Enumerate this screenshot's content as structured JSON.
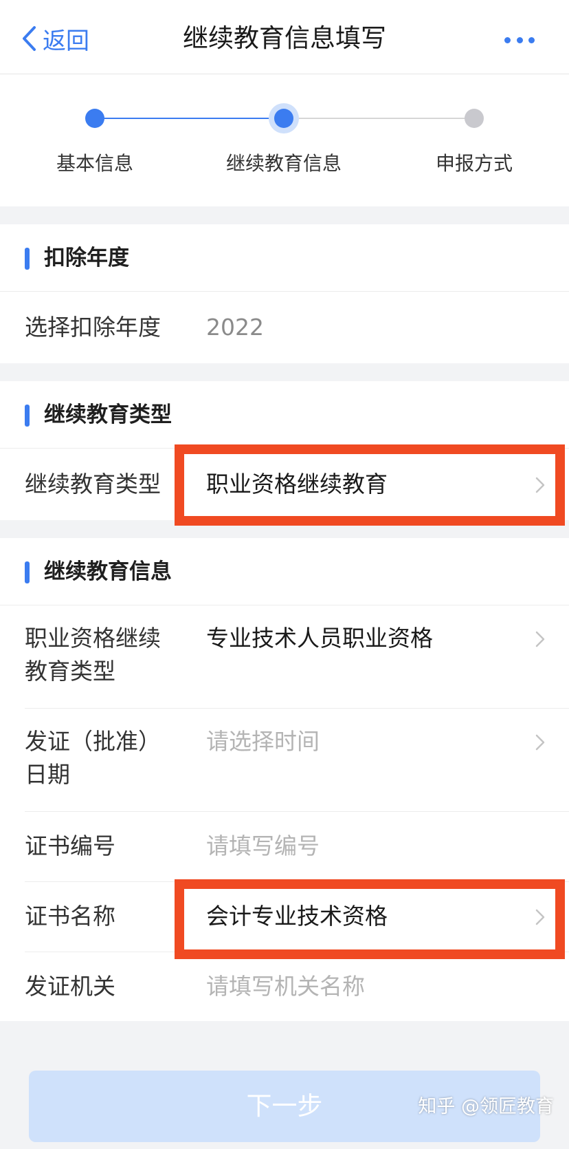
{
  "header": {
    "back_label": "返回",
    "title": "继续教育信息填写",
    "more_icon": "ellipsis-icon"
  },
  "steps": [
    {
      "label": "基本信息",
      "state": "done"
    },
    {
      "label": "继续教育信息",
      "state": "current"
    },
    {
      "label": "申报方式",
      "state": "todo"
    }
  ],
  "section_year": {
    "title": "扣除年度",
    "rows": [
      {
        "label": "选择扣除年度",
        "value": "2022"
      }
    ]
  },
  "section_type": {
    "title": "继续教育类型",
    "rows": [
      {
        "label": "继续教育类型",
        "value": "职业资格继续教育"
      }
    ]
  },
  "section_info": {
    "title": "继续教育信息",
    "rows": [
      {
        "label": "职业资格继续教育类型",
        "value": "专业技术人员职业资格"
      },
      {
        "label": "发证（批准）日期",
        "placeholder": "请选择时间"
      },
      {
        "label": "证书编号",
        "placeholder": "请填写编号"
      },
      {
        "label": "证书名称",
        "value": "会计专业技术资格"
      },
      {
        "label": "发证机关",
        "placeholder": "请填写机关名称"
      }
    ]
  },
  "footer": {
    "next_label": "下一步",
    "watermark": "知乎 @领匠教育"
  },
  "colors": {
    "accent": "#3b7cf0",
    "highlight": "#f04a22",
    "button_disabled": "#cfe1fb"
  }
}
